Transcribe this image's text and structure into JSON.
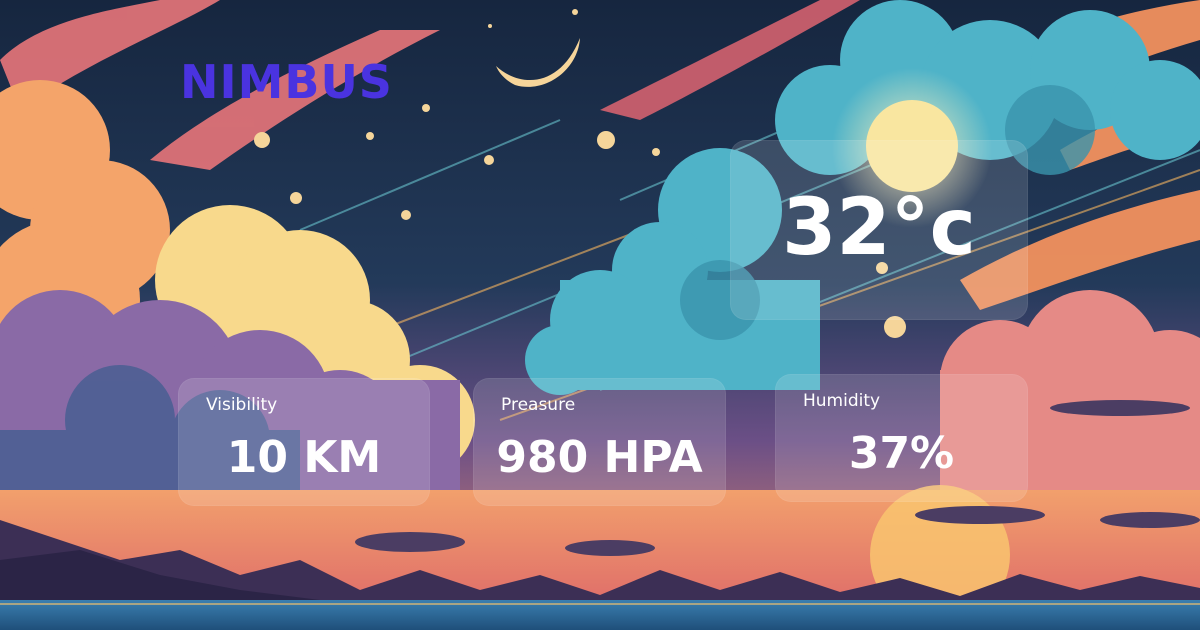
{
  "app": {
    "brand": "NIMBUS",
    "brand_color": "#4a33e0"
  },
  "current": {
    "temperature": "32°c"
  },
  "stats": [
    {
      "label": "Visibility",
      "value": "10 KM"
    },
    {
      "label": "Preasure",
      "value": "980 HPA"
    },
    {
      "label": "Humidity",
      "value": "37%"
    }
  ],
  "background": {
    "scene": "dusk-sky-illustration",
    "sky_color": "#1c2f4d",
    "accent_colors": [
      "#f08a5d",
      "#f6c36b",
      "#4fb3c8",
      "#8a5a9e"
    ]
  }
}
